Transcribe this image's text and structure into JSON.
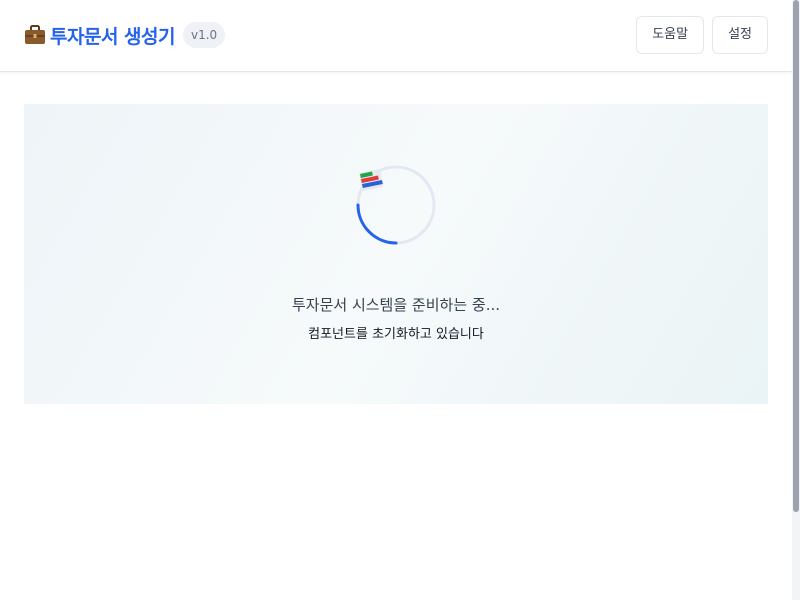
{
  "app": {
    "title": "투자문서 생성기",
    "version": "v1.0",
    "brand_icon": "briefcase-icon"
  },
  "header": {
    "help_label": "도움말",
    "settings_label": "설정"
  },
  "loading": {
    "title": "투자문서 시스템을 준비하는 중...",
    "subtitle": "컴포넌트를 초기화하고 있습니다",
    "icon": "bar-chart-icon"
  },
  "colors": {
    "accent": "#2563eb",
    "spinner_track": "#e3e8f2",
    "chart_green": "#22a447",
    "chart_red": "#e23b3b",
    "chart_blue": "#2a62d8"
  }
}
